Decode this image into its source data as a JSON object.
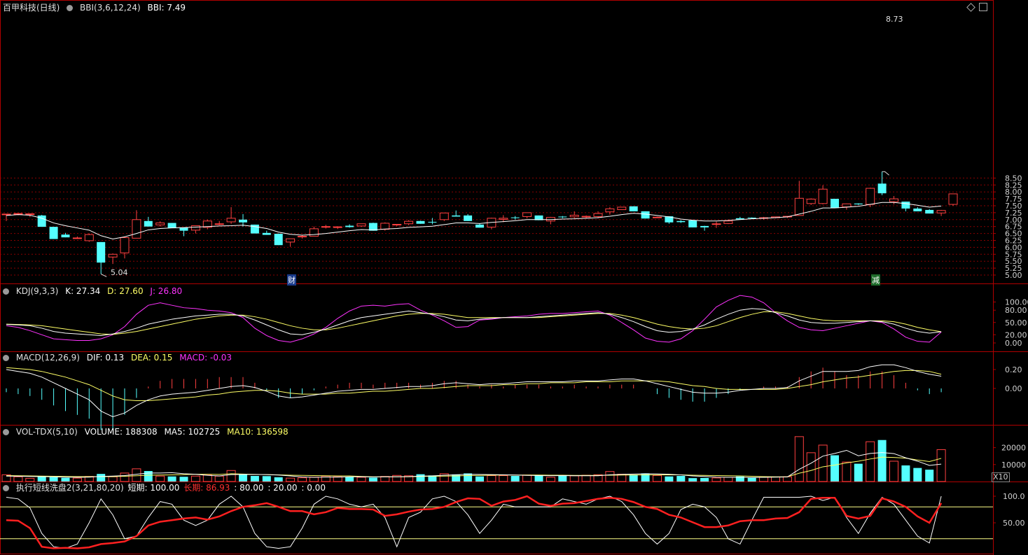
{
  "colors": {
    "up": "#ff4040",
    "down": "#54ffff",
    "bbi": "#ffffff",
    "grid": "#8a0000",
    "axis": "#b00000",
    "yellow": "#ffff66",
    "magenta": "#ff33ff",
    "white": "#ffffff",
    "red": "#ff2020"
  },
  "main": {
    "title": "百甲科技(日线)",
    "indicator": "BBI(3,6,12,24)",
    "bbi_label": "BBI: 7.49",
    "high_label": "8.73",
    "low_label": "5.04",
    "marker_cai": "财",
    "marker_jian": "减",
    "ticks": [
      "8.50",
      "8.25",
      "8.00",
      "7.75",
      "7.50",
      "7.25",
      "7.00",
      "6.75",
      "6.50",
      "6.25",
      "6.00",
      "5.75",
      "5.50",
      "5.25",
      "5.00"
    ]
  },
  "kdj": {
    "name": "KDJ(9,3,3)",
    "k": "K: 27.34",
    "d": "D: 27.60",
    "j": "J: 26.80",
    "ticks": [
      "100.00",
      "80.00",
      "50.00",
      "20.00",
      "0.00"
    ]
  },
  "macd": {
    "name": "MACD(12,26,9)",
    "dif": "DIF: 0.13",
    "dea": "DEA: 0.15",
    "macd": "MACD: -0.03",
    "ticks": [
      "0.20",
      "0.00"
    ]
  },
  "vol": {
    "name": "VOL-TDX(5,10)",
    "volume": "VOLUME: 188308",
    "ma5": "MA5: 102725",
    "ma10": "MA10: 136598",
    "ticks": [
      "20000",
      "10000"
    ],
    "unit": "X10"
  },
  "wash": {
    "name": "执行短线洗盘2(3,21,80,20)",
    "short": "短期: 100.00",
    "long": "长期: 86.93",
    "l80": ": 80.00",
    "l20": ": 20.00",
    "zero": ": 0.00",
    "ticks": [
      "100.0",
      "50.00"
    ]
  },
  "chart_data": {
    "type": "candlestick",
    "n": 80,
    "candles": [
      [
        7.19,
        7.2,
        6.95,
        7.2
      ],
      [
        7.2,
        7.22,
        7.16,
        7.22
      ],
      [
        7.19,
        7.21,
        7.09,
        7.21
      ],
      [
        7.15,
        7.17,
        6.74,
        6.74
      ],
      [
        6.74,
        6.74,
        6.3,
        6.3
      ],
      [
        6.46,
        6.52,
        6.36,
        6.36
      ],
      [
        6.34,
        6.39,
        6.3,
        6.34
      ],
      [
        6.24,
        6.5,
        6.2,
        6.46
      ],
      [
        6.19,
        6.19,
        5.04,
        5.45
      ],
      [
        5.65,
        5.78,
        5.4,
        5.75
      ],
      [
        5.8,
        6.38,
        5.6,
        6.35
      ],
      [
        6.33,
        7.34,
        6.33,
        7.0
      ],
      [
        6.95,
        7.1,
        6.75,
        6.75
      ],
      [
        6.81,
        6.94,
        6.75,
        6.88
      ],
      [
        6.88,
        6.88,
        6.7,
        6.7
      ],
      [
        6.72,
        6.72,
        6.4,
        6.6
      ],
      [
        6.62,
        6.78,
        6.5,
        6.78
      ],
      [
        6.72,
        7.0,
        6.65,
        6.95
      ],
      [
        6.85,
        6.95,
        6.8,
        6.85
      ],
      [
        6.92,
        7.45,
        6.85,
        7.05
      ],
      [
        7.0,
        7.2,
        6.75,
        6.9
      ],
      [
        6.82,
        6.82,
        6.5,
        6.5
      ],
      [
        6.52,
        6.6,
        6.45,
        6.45
      ],
      [
        6.49,
        6.5,
        6.08,
        6.08
      ],
      [
        6.19,
        6.31,
        6.02,
        6.31
      ],
      [
        6.4,
        6.43,
        6.32,
        6.4
      ],
      [
        6.4,
        6.75,
        6.4,
        6.67
      ],
      [
        6.75,
        6.81,
        6.68,
        6.75
      ],
      [
        6.73,
        6.76,
        6.66,
        6.74
      ],
      [
        6.78,
        6.83,
        6.71,
        6.73
      ],
      [
        6.77,
        6.85,
        6.74,
        6.85
      ],
      [
        6.88,
        6.89,
        6.6,
        6.6
      ],
      [
        6.65,
        6.9,
        6.6,
        6.87
      ],
      [
        6.81,
        6.83,
        6.77,
        6.83
      ],
      [
        6.85,
        6.98,
        6.8,
        6.94
      ],
      [
        6.95,
        6.96,
        6.85,
        6.85
      ],
      [
        6.92,
        7.06,
        6.83,
        6.91
      ],
      [
        7.0,
        7.25,
        6.95,
        7.24
      ],
      [
        7.15,
        7.33,
        7.11,
        7.11
      ],
      [
        7.15,
        7.2,
        6.95,
        6.95
      ],
      [
        6.82,
        6.85,
        6.71,
        6.71
      ],
      [
        6.73,
        7.07,
        6.65,
        7.05
      ],
      [
        7.01,
        7.16,
        6.91,
        7.05
      ],
      [
        7.08,
        7.13,
        7.0,
        7.07
      ],
      [
        7.11,
        7.25,
        7.05,
        7.25
      ],
      [
        7.15,
        7.15,
        6.98,
        6.98
      ],
      [
        6.95,
        7.1,
        6.83,
        7.08
      ],
      [
        7.11,
        7.13,
        7.05,
        7.09
      ],
      [
        7.1,
        7.3,
        7.05,
        7.16
      ],
      [
        7.1,
        7.15,
        7.05,
        7.12
      ],
      [
        7.11,
        7.3,
        7.05,
        7.22
      ],
      [
        7.28,
        7.45,
        7.18,
        7.39
      ],
      [
        7.36,
        7.45,
        7.35,
        7.45
      ],
      [
        7.48,
        7.48,
        7.3,
        7.3
      ],
      [
        7.3,
        7.3,
        7.04,
        7.04
      ],
      [
        7.09,
        7.11,
        7.06,
        7.09
      ],
      [
        7.12,
        7.12,
        6.85,
        6.9
      ],
      [
        6.95,
        6.98,
        6.88,
        6.91
      ],
      [
        6.97,
        6.97,
        6.72,
        6.72
      ],
      [
        6.77,
        6.78,
        6.6,
        6.72
      ],
      [
        6.85,
        6.93,
        6.7,
        6.85
      ],
      [
        6.86,
        7.0,
        6.84,
        6.95
      ],
      [
        7.05,
        7.1,
        7.01,
        7.01
      ],
      [
        7.07,
        7.08,
        7.02,
        7.05
      ],
      [
        7.05,
        7.1,
        7.0,
        7.07
      ],
      [
        7.07,
        7.11,
        7.05,
        7.1
      ],
      [
        7.11,
        7.13,
        7.06,
        7.12
      ],
      [
        7.15,
        8.4,
        7.15,
        7.77
      ],
      [
        7.58,
        7.77,
        7.53,
        7.74
      ],
      [
        7.58,
        8.24,
        7.55,
        8.1
      ],
      [
        7.75,
        7.75,
        7.42,
        7.42
      ],
      [
        7.46,
        7.58,
        7.36,
        7.57
      ],
      [
        7.58,
        7.59,
        7.53,
        7.55
      ],
      [
        7.55,
        8.15,
        7.45,
        8.13
      ],
      [
        8.3,
        8.73,
        7.88,
        7.95
      ],
      [
        7.65,
        7.85,
        7.55,
        7.75
      ],
      [
        7.65,
        7.65,
        7.3,
        7.4
      ],
      [
        7.4,
        7.45,
        7.32,
        7.3
      ],
      [
        7.35,
        7.38,
        7.22,
        7.22
      ],
      [
        7.24,
        7.35,
        7.13,
        7.33
      ],
      [
        7.55,
        7.93,
        7.5,
        7.93
      ]
    ],
    "bbi": [
      7.15,
      7.18,
      7.16,
      7.05,
      6.88,
      6.78,
      6.7,
      6.62,
      6.42,
      6.3,
      6.38,
      6.5,
      6.63,
      6.68,
      6.7,
      6.71,
      6.73,
      6.75,
      6.77,
      6.78,
      6.8,
      6.75,
      6.68,
      6.55,
      6.47,
      6.44,
      6.46,
      6.5,
      6.55,
      6.6,
      6.64,
      6.63,
      6.66,
      6.68,
      6.72,
      6.74,
      6.76,
      6.82,
      6.88,
      6.88,
      6.86,
      6.9,
      6.93,
      6.96,
      7.0,
      7.0,
      7.0,
      7.02,
      7.03,
      7.05,
      7.07,
      7.12,
      7.18,
      7.23,
      7.2,
      7.15,
      7.1,
      7.02,
      6.98,
      6.95,
      6.95,
      6.97,
      7.0,
      7.03,
      7.05,
      7.07,
      7.1,
      7.2,
      7.3,
      7.42,
      7.42,
      7.45,
      7.48,
      7.55,
      7.62,
      7.62,
      7.58,
      7.52,
      7.45,
      7.49
    ],
    "kdj": {
      "k": [
        45,
        44,
        42,
        36,
        28,
        24,
        22,
        20,
        18,
        22,
        28,
        36,
        46,
        52,
        58,
        62,
        66,
        68,
        70,
        70,
        66,
        56,
        44,
        32,
        22,
        20,
        26,
        34,
        44,
        54,
        62,
        66,
        70,
        74,
        78,
        74,
        70,
        64,
        56,
        54,
        58,
        60,
        62,
        62,
        62,
        64,
        66,
        68,
        70,
        72,
        74,
        70,
        62,
        52,
        40,
        30,
        26,
        28,
        34,
        44,
        58,
        70,
        80,
        84,
        82,
        74,
        66,
        56,
        50,
        48,
        48,
        50,
        52,
        54,
        52,
        46,
        36,
        28,
        24,
        27.34
      ],
      "d": [
        46,
        45,
        44,
        42,
        38,
        34,
        30,
        26,
        22,
        21,
        24,
        28,
        34,
        40,
        46,
        52,
        58,
        62,
        66,
        68,
        68,
        64,
        58,
        50,
        42,
        36,
        32,
        32,
        36,
        42,
        48,
        54,
        60,
        66,
        70,
        72,
        72,
        70,
        66,
        62,
        62,
        62,
        62,
        62,
        62,
        62,
        64,
        66,
        68,
        70,
        72,
        72,
        68,
        62,
        54,
        46,
        40,
        36,
        34,
        36,
        42,
        52,
        62,
        70,
        76,
        76,
        72,
        66,
        60,
        56,
        54,
        54,
        54,
        54,
        54,
        52,
        46,
        38,
        32,
        27.6
      ],
      "j": [
        42,
        38,
        30,
        20,
        10,
        8,
        6,
        6,
        10,
        20,
        40,
        70,
        92,
        98,
        92,
        86,
        84,
        80,
        78,
        74,
        62,
        36,
        18,
        6,
        2,
        10,
        22,
        38,
        60,
        78,
        90,
        92,
        90,
        94,
        96,
        80,
        68,
        54,
        38,
        40,
        56,
        58,
        62,
        64,
        66,
        70,
        72,
        72,
        74,
        76,
        78,
        68,
        50,
        32,
        12,
        4,
        2,
        10,
        30,
        58,
        88,
        104,
        116,
        112,
        98,
        74,
        54,
        38,
        32,
        30,
        36,
        42,
        48,
        54,
        50,
        34,
        14,
        4,
        2,
        26.8
      ]
    },
    "macd": {
      "dif": [
        0.2,
        0.18,
        0.16,
        0.12,
        0.06,
        0.0,
        -0.06,
        -0.12,
        -0.24,
        -0.3,
        -0.26,
        -0.18,
        -0.12,
        -0.08,
        -0.06,
        -0.05,
        -0.04,
        -0.02,
        0.0,
        0.02,
        0.03,
        0.01,
        -0.03,
        -0.08,
        -0.1,
        -0.09,
        -0.07,
        -0.05,
        -0.03,
        -0.02,
        -0.01,
        -0.01,
        0.0,
        0.01,
        0.02,
        0.02,
        0.03,
        0.05,
        0.06,
        0.05,
        0.04,
        0.05,
        0.05,
        0.06,
        0.07,
        0.07,
        0.07,
        0.07,
        0.08,
        0.08,
        0.08,
        0.09,
        0.1,
        0.1,
        0.08,
        0.05,
        0.02,
        -0.01,
        -0.04,
        -0.05,
        -0.05,
        -0.04,
        -0.02,
        -0.01,
        0.0,
        0.0,
        0.01,
        0.08,
        0.13,
        0.18,
        0.18,
        0.18,
        0.19,
        0.23,
        0.25,
        0.25,
        0.22,
        0.18,
        0.15,
        0.13
      ],
      "dea": [
        0.22,
        0.21,
        0.2,
        0.18,
        0.15,
        0.12,
        0.08,
        0.04,
        -0.02,
        -0.08,
        -0.12,
        -0.13,
        -0.13,
        -0.12,
        -0.11,
        -0.1,
        -0.09,
        -0.07,
        -0.06,
        -0.04,
        -0.03,
        -0.02,
        -0.02,
        -0.03,
        -0.05,
        -0.06,
        -0.06,
        -0.06,
        -0.05,
        -0.05,
        -0.04,
        -0.03,
        -0.03,
        -0.02,
        -0.01,
        0.0,
        0.0,
        0.01,
        0.02,
        0.03,
        0.03,
        0.03,
        0.04,
        0.04,
        0.05,
        0.05,
        0.06,
        0.06,
        0.06,
        0.07,
        0.07,
        0.07,
        0.08,
        0.08,
        0.08,
        0.08,
        0.07,
        0.05,
        0.03,
        0.02,
        0.0,
        -0.01,
        -0.01,
        -0.01,
        -0.01,
        -0.01,
        0.0,
        0.02,
        0.04,
        0.07,
        0.09,
        0.11,
        0.12,
        0.14,
        0.16,
        0.18,
        0.19,
        0.19,
        0.18,
        0.15
      ]
    },
    "volume": {
      "values": [
        4000,
        2800,
        1900,
        2800,
        2600,
        2200,
        2000,
        3000,
        4500,
        2800,
        5000,
        7500,
        6200,
        3200,
        3000,
        2800,
        3200,
        3800,
        3200,
        6500,
        4500,
        3300,
        3200,
        2500,
        2000,
        2200,
        2600,
        3200,
        2800,
        2800,
        2500,
        2300,
        3000,
        3600,
        3400,
        4300,
        3600,
        4600,
        4200,
        4800,
        3000,
        3500,
        3500,
        3300,
        3800,
        3600,
        2500,
        3600,
        3400,
        3700,
        4000,
        5900,
        4300,
        4000,
        4800,
        3600,
        3000,
        3300,
        2000,
        2100,
        2100,
        2500,
        3000,
        2200,
        2500,
        2700,
        2800,
        26500,
        17000,
        21500,
        15500,
        11500,
        10500,
        23500,
        24500,
        12000,
        9500,
        8000,
        7000,
        18830
      ],
      "ma5": [
        3200,
        3100,
        3000,
        2900,
        2800,
        2600,
        2500,
        2600,
        3000,
        3200,
        3500,
        4300,
        5000,
        5000,
        5200,
        4600,
        4300,
        3600,
        3300,
        4100,
        4200,
        4200,
        4100,
        3800,
        3300,
        2700,
        2500,
        2600,
        2600,
        2800,
        2800,
        2700,
        2800,
        2800,
        2900,
        3200,
        3300,
        3700,
        4000,
        4300,
        4200,
        4100,
        4000,
        3800,
        3600,
        3500,
        3400,
        3500,
        3400,
        3400,
        3400,
        4000,
        4200,
        4400,
        4600,
        4500,
        4300,
        3900,
        3300,
        3000,
        2600,
        2500,
        2500,
        2400,
        2500,
        2600,
        2700,
        7200,
        10800,
        15000,
        16600,
        18400,
        15200,
        16600,
        17100,
        16500,
        14000,
        12000,
        9500,
        10272
      ],
      "ma10": [
        3500,
        3400,
        3300,
        3200,
        3100,
        3000,
        2900,
        2900,
        2900,
        2900,
        3100,
        3400,
        3700,
        3800,
        3900,
        4100,
        4300,
        4300,
        4200,
        4600,
        4400,
        4200,
        4100,
        3900,
        3700,
        3600,
        3500,
        3400,
        3300,
        3300,
        3000,
        2800,
        2800,
        2800,
        2800,
        3000,
        3100,
        3200,
        3300,
        3500,
        3600,
        3700,
        3800,
        3800,
        3800,
        3800,
        3700,
        3700,
        3600,
        3600,
        3600,
        3700,
        3800,
        3800,
        3900,
        3900,
        3900,
        3900,
        3700,
        3600,
        3500,
        3400,
        3300,
        3100,
        2900,
        2800,
        2800,
        4900,
        6500,
        8700,
        9700,
        11000,
        12000,
        13300,
        14400,
        14200,
        13800,
        12700,
        11800,
        13660
      ]
    },
    "wash": {
      "short": [
        98,
        95,
        78,
        30,
        5,
        2,
        10,
        50,
        95,
        65,
        20,
        25,
        60,
        90,
        85,
        55,
        45,
        55,
        85,
        100,
        80,
        30,
        5,
        2,
        5,
        40,
        85,
        100,
        95,
        85,
        80,
        85,
        60,
        5,
        60,
        70,
        95,
        100,
        90,
        65,
        30,
        55,
        85,
        80,
        80,
        80,
        80,
        95,
        90,
        85,
        95,
        100,
        90,
        65,
        30,
        10,
        30,
        75,
        85,
        80,
        60,
        20,
        10,
        55,
        98,
        98,
        98,
        98,
        100,
        92,
        98,
        60,
        30,
        68,
        98,
        85,
        55,
        25,
        12,
        100
      ],
      "long": [
        55,
        54,
        40,
        5,
        2,
        3,
        2,
        4,
        10,
        12,
        15,
        25,
        45,
        52,
        55,
        58,
        60,
        56,
        62,
        72,
        80,
        83,
        87,
        80,
        72,
        72,
        66,
        70,
        78,
        76,
        76,
        75,
        63,
        66,
        71,
        75,
        76,
        80,
        89,
        96,
        95,
        82,
        90,
        93,
        100,
        86,
        82,
        86,
        87,
        91,
        95,
        97,
        95,
        89,
        80,
        76,
        65,
        60,
        51,
        42,
        42,
        45,
        53,
        55,
        55,
        58,
        59,
        70,
        95,
        97,
        97,
        63,
        58,
        63,
        96,
        90,
        80,
        62,
        50,
        86.93
      ]
    }
  }
}
